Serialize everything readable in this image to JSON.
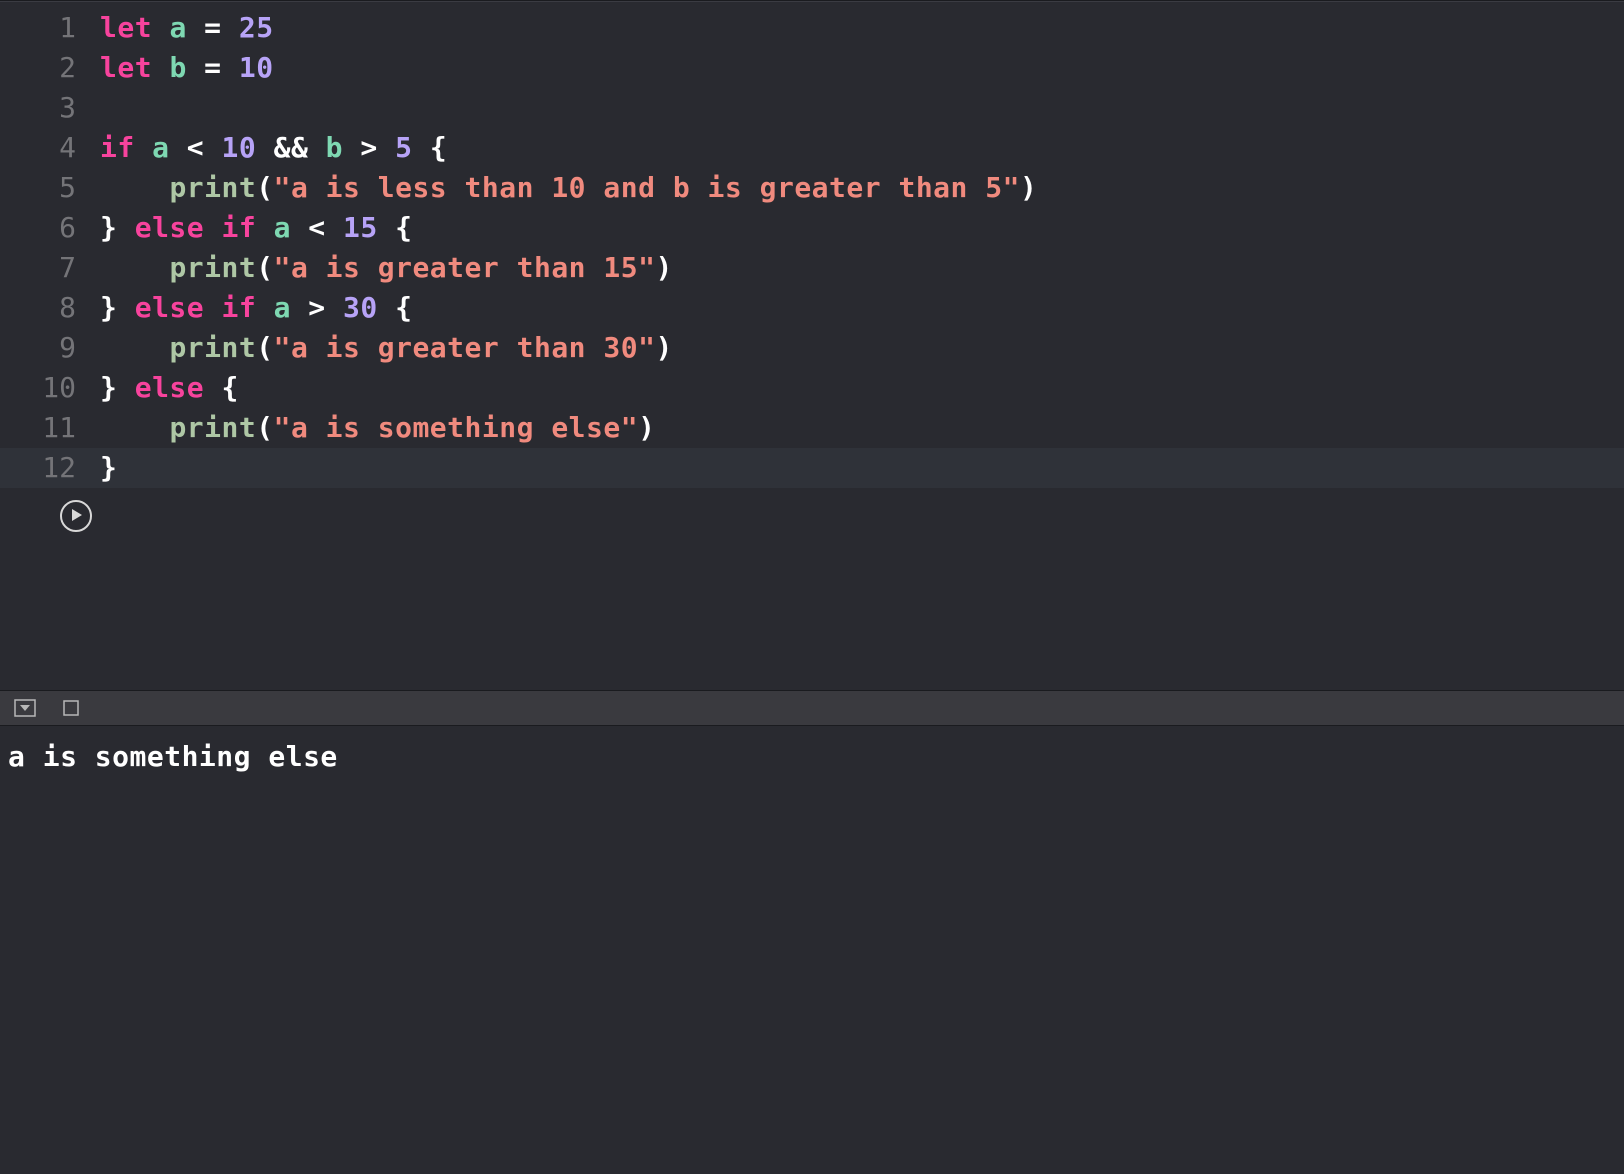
{
  "editor": {
    "lines": [
      {
        "num": "1",
        "tokens": [
          {
            "cls": "tok-keyword",
            "t": "let"
          },
          {
            "cls": "tok-op",
            "t": " "
          },
          {
            "cls": "tok-ident",
            "t": "a"
          },
          {
            "cls": "tok-op",
            "t": " = "
          },
          {
            "cls": "tok-number",
            "t": "25"
          }
        ]
      },
      {
        "num": "2",
        "tokens": [
          {
            "cls": "tok-keyword",
            "t": "let"
          },
          {
            "cls": "tok-op",
            "t": " "
          },
          {
            "cls": "tok-ident",
            "t": "b"
          },
          {
            "cls": "tok-op",
            "t": " = "
          },
          {
            "cls": "tok-number",
            "t": "10"
          }
        ]
      },
      {
        "num": "3",
        "tokens": []
      },
      {
        "num": "4",
        "tokens": [
          {
            "cls": "tok-keyword",
            "t": "if"
          },
          {
            "cls": "tok-op",
            "t": " "
          },
          {
            "cls": "tok-ident",
            "t": "a"
          },
          {
            "cls": "tok-op",
            "t": " < "
          },
          {
            "cls": "tok-number",
            "t": "10"
          },
          {
            "cls": "tok-op",
            "t": " && "
          },
          {
            "cls": "tok-ident",
            "t": "b"
          },
          {
            "cls": "tok-op",
            "t": " > "
          },
          {
            "cls": "tok-number",
            "t": "5"
          },
          {
            "cls": "tok-op",
            "t": " "
          },
          {
            "cls": "tok-brace",
            "t": "{"
          }
        ]
      },
      {
        "num": "5",
        "tokens": [
          {
            "cls": "tok-op",
            "t": "    "
          },
          {
            "cls": "tok-func",
            "t": "print"
          },
          {
            "cls": "tok-paren",
            "t": "("
          },
          {
            "cls": "tok-string",
            "t": "\"a is less than 10 and b is greater than 5\""
          },
          {
            "cls": "tok-paren",
            "t": ")"
          }
        ]
      },
      {
        "num": "6",
        "tokens": [
          {
            "cls": "tok-brace",
            "t": "}"
          },
          {
            "cls": "tok-op",
            "t": " "
          },
          {
            "cls": "tok-keyword",
            "t": "else"
          },
          {
            "cls": "tok-op",
            "t": " "
          },
          {
            "cls": "tok-keyword",
            "t": "if"
          },
          {
            "cls": "tok-op",
            "t": " "
          },
          {
            "cls": "tok-ident",
            "t": "a"
          },
          {
            "cls": "tok-op",
            "t": " < "
          },
          {
            "cls": "tok-number",
            "t": "15"
          },
          {
            "cls": "tok-op",
            "t": " "
          },
          {
            "cls": "tok-brace",
            "t": "{"
          }
        ]
      },
      {
        "num": "7",
        "tokens": [
          {
            "cls": "tok-op",
            "t": "    "
          },
          {
            "cls": "tok-func",
            "t": "print"
          },
          {
            "cls": "tok-paren",
            "t": "("
          },
          {
            "cls": "tok-string",
            "t": "\"a is greater than 15\""
          },
          {
            "cls": "tok-paren",
            "t": ")"
          }
        ]
      },
      {
        "num": "8",
        "tokens": [
          {
            "cls": "tok-brace",
            "t": "}"
          },
          {
            "cls": "tok-op",
            "t": " "
          },
          {
            "cls": "tok-keyword",
            "t": "else"
          },
          {
            "cls": "tok-op",
            "t": " "
          },
          {
            "cls": "tok-keyword",
            "t": "if"
          },
          {
            "cls": "tok-op",
            "t": " "
          },
          {
            "cls": "tok-ident",
            "t": "a"
          },
          {
            "cls": "tok-op",
            "t": " > "
          },
          {
            "cls": "tok-number",
            "t": "30"
          },
          {
            "cls": "tok-op",
            "t": " "
          },
          {
            "cls": "tok-brace",
            "t": "{"
          }
        ]
      },
      {
        "num": "9",
        "tokens": [
          {
            "cls": "tok-op",
            "t": "    "
          },
          {
            "cls": "tok-func",
            "t": "print"
          },
          {
            "cls": "tok-paren",
            "t": "("
          },
          {
            "cls": "tok-string",
            "t": "\"a is greater than 30\""
          },
          {
            "cls": "tok-paren",
            "t": ")"
          }
        ]
      },
      {
        "num": "10",
        "tokens": [
          {
            "cls": "tok-brace",
            "t": "}"
          },
          {
            "cls": "tok-op",
            "t": " "
          },
          {
            "cls": "tok-keyword",
            "t": "else"
          },
          {
            "cls": "tok-op",
            "t": " "
          },
          {
            "cls": "tok-brace",
            "t": "{"
          }
        ]
      },
      {
        "num": "11",
        "tokens": [
          {
            "cls": "tok-op",
            "t": "    "
          },
          {
            "cls": "tok-func",
            "t": "print"
          },
          {
            "cls": "tok-paren",
            "t": "("
          },
          {
            "cls": "tok-string",
            "t": "\"a is something else\""
          },
          {
            "cls": "tok-paren",
            "t": ")"
          }
        ]
      },
      {
        "num": "12",
        "current": true,
        "tokens": [
          {
            "cls": "tok-brace",
            "t": "}"
          }
        ]
      }
    ]
  },
  "console": {
    "output": "a is something else"
  }
}
